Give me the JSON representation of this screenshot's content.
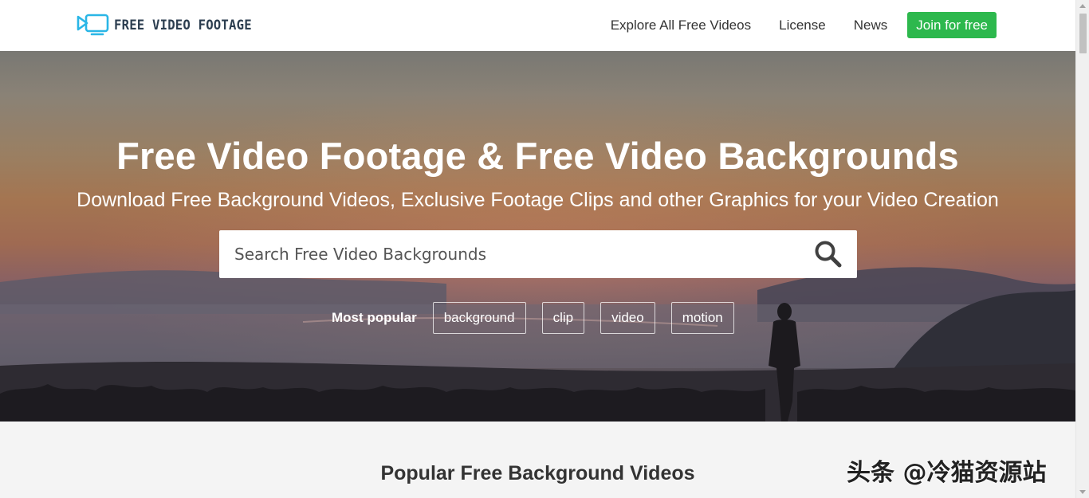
{
  "header": {
    "logo_text": "FREE VIDEO FOOTAGE",
    "nav": [
      {
        "label": "Explore All Free Videos"
      },
      {
        "label": "License"
      },
      {
        "label": "News"
      }
    ],
    "join_label": "Join for free"
  },
  "hero": {
    "title": "Free Video Footage & Free Video Backgrounds",
    "subtitle": "Download Free Background Videos, Exclusive Footage Clips and other Graphics for your Video Creation",
    "search_placeholder": "Search Free Video Backgrounds",
    "popular_label": "Most popular",
    "tags": [
      "background",
      "clip",
      "video",
      "motion"
    ]
  },
  "section": {
    "title": "Popular Free Background Videos"
  },
  "watermark": "头条 @冷猫资源站",
  "colors": {
    "join_button": "#2db84d",
    "logo_accent": "#2ab6e6",
    "logo_text": "#2c3e50"
  },
  "icons": {
    "logo": "video-camera-icon",
    "search": "search-icon"
  }
}
